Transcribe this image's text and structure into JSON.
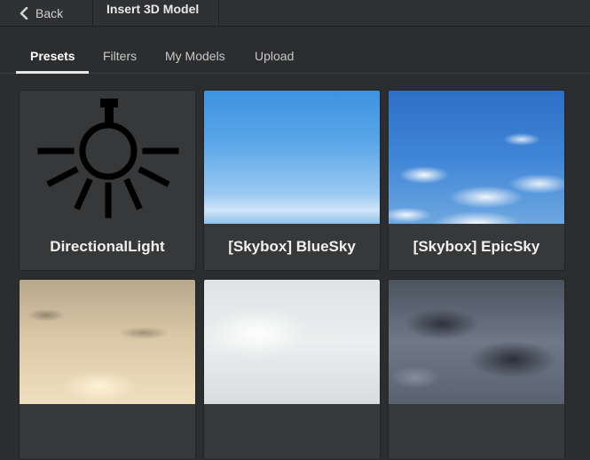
{
  "header": {
    "back_label": "Back",
    "title": "Insert 3D Model"
  },
  "tabs": [
    {
      "label": "Presets",
      "active": true
    },
    {
      "label": "Filters",
      "active": false
    },
    {
      "label": "My Models",
      "active": false
    },
    {
      "label": "Upload",
      "active": false
    }
  ],
  "presets": [
    {
      "label": "DirectionalLight",
      "icon": "light-bulb-icon"
    },
    {
      "label": "[Skybox] BlueSky"
    },
    {
      "label": "[Skybox] EpicSky"
    },
    {
      "label": ""
    },
    {
      "label": ""
    },
    {
      "label": ""
    }
  ],
  "colors": {
    "background": "#2b2d2f",
    "card": "#36383a",
    "accent_underline": "#e6e6e6"
  }
}
